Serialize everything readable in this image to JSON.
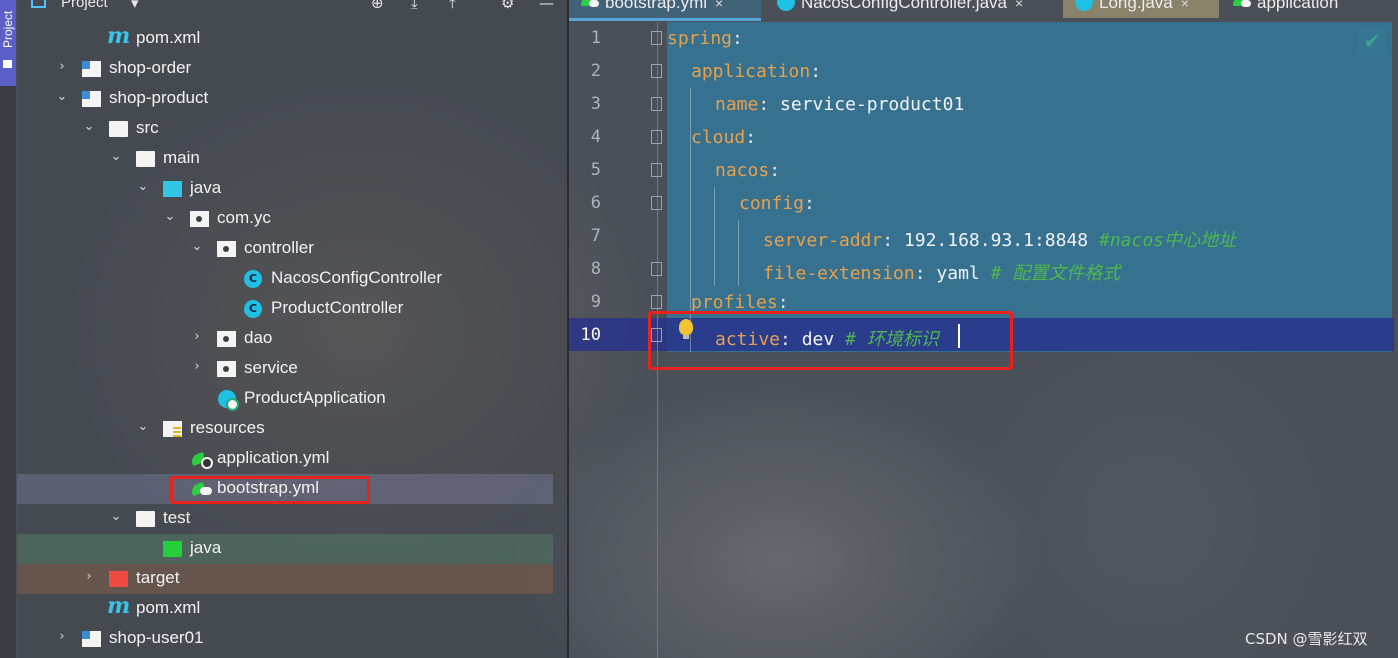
{
  "project_panel": {
    "vertical_tab": "Project",
    "title": "Project",
    "header_icons": [
      "target-icon",
      "collapse-icon",
      "expand-icon",
      "gear-icon",
      "minimize-icon"
    ],
    "tree": [
      {
        "label": "pom.xml",
        "icon": "maven-icon",
        "chevron": ""
      },
      {
        "label": "shop-order",
        "icon": "module-folder-icon",
        "chevron": "›"
      },
      {
        "label": "shop-product",
        "icon": "module-folder-icon",
        "chevron": "⌄"
      },
      {
        "label": "src",
        "icon": "folder-icon",
        "chevron": "⌄"
      },
      {
        "label": "main",
        "icon": "folder-icon",
        "chevron": "⌄"
      },
      {
        "label": "java",
        "icon": "source-folder-icon",
        "chevron": "⌄"
      },
      {
        "label": "com.yc",
        "icon": "package-icon",
        "chevron": "⌄"
      },
      {
        "label": "controller",
        "icon": "package-icon",
        "chevron": "⌄"
      },
      {
        "label": "NacosConfigController",
        "icon": "class-icon",
        "chevron": ""
      },
      {
        "label": "ProductController",
        "icon": "class-icon",
        "chevron": ""
      },
      {
        "label": "dao",
        "icon": "package-icon",
        "chevron": "›"
      },
      {
        "label": "service",
        "icon": "package-icon",
        "chevron": "›"
      },
      {
        "label": "ProductApplication",
        "icon": "spring-app-class-icon",
        "chevron": ""
      },
      {
        "label": "resources",
        "icon": "resources-folder-icon",
        "chevron": "⌄"
      },
      {
        "label": "application.yml",
        "icon": "yaml-config-icon",
        "chevron": ""
      },
      {
        "label": "bootstrap.yml",
        "icon": "yaml-bootstrap-icon",
        "chevron": ""
      },
      {
        "label": "test",
        "icon": "folder-icon",
        "chevron": "⌄"
      },
      {
        "label": "java",
        "icon": "test-folder-icon",
        "chevron": ""
      },
      {
        "label": "target",
        "icon": "excluded-folder-icon",
        "chevron": "›"
      },
      {
        "label": "pom.xml",
        "icon": "maven-icon",
        "chevron": ""
      },
      {
        "label": "shop-user01",
        "icon": "module-folder-icon",
        "chevron": "›"
      }
    ]
  },
  "editor": {
    "tabs": [
      {
        "label": "bootstrap.yml",
        "close": "×",
        "active": true
      },
      {
        "label": "NacosConfigController.java",
        "close": "×",
        "active": false
      },
      {
        "label": "Long.java",
        "close": "×",
        "active": false
      },
      {
        "label": "application",
        "close": "",
        "active": false
      }
    ],
    "lines": [
      {
        "n": "1",
        "key": "spring",
        "value": "",
        "comment": ""
      },
      {
        "n": "2",
        "key": "application",
        "value": "",
        "comment": ""
      },
      {
        "n": "3",
        "key": "name",
        "value": "service-product01",
        "comment": ""
      },
      {
        "n": "4",
        "key": "cloud",
        "value": "",
        "comment": ""
      },
      {
        "n": "5",
        "key": "nacos",
        "value": "",
        "comment": ""
      },
      {
        "n": "6",
        "key": "config",
        "value": "",
        "comment": ""
      },
      {
        "n": "7",
        "key": "server-addr",
        "value": "192.168.93.1:8848",
        "comment": "#nacos中心地址"
      },
      {
        "n": "8",
        "key": "file-extension",
        "value": "yaml",
        "comment": "# 配置文件格式"
      },
      {
        "n": "9",
        "key": "profiles",
        "value": "",
        "comment": ""
      },
      {
        "n": "10",
        "key": "active",
        "value": "dev",
        "comment": "# 环境标识"
      }
    ],
    "current_line": "10",
    "inspection_status": "✔"
  },
  "watermark": "CSDN @雪影红双",
  "colors": {
    "accent": "#5b5fc7",
    "yaml_key": "#e8a14a",
    "comment": "#4fb74e",
    "highlight_box": "#e8221c"
  }
}
